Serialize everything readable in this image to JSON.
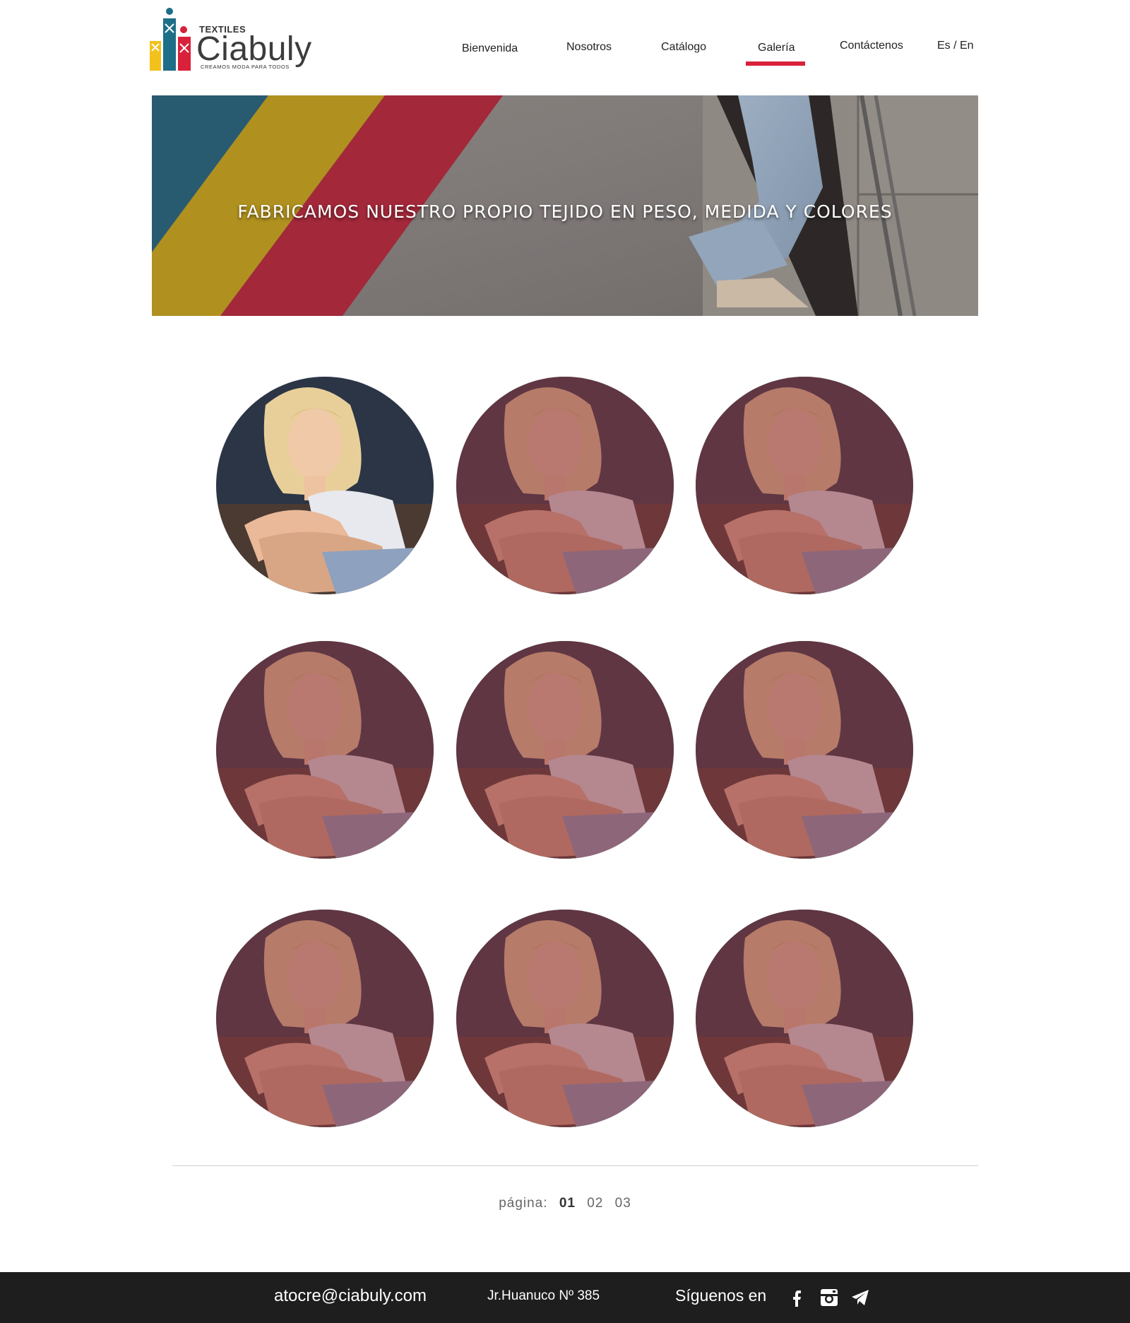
{
  "brand": {
    "small": "TEXTILES",
    "name": "Ciabuly",
    "tagline": "CREAMOS MODA PARA TODOS",
    "colors": {
      "blue": "#1e6e88",
      "yellow": "#f2c11c",
      "red": "#d9213b"
    }
  },
  "nav": {
    "items": [
      {
        "label": "Bienvenida"
      },
      {
        "label": "Nosotros"
      },
      {
        "label": "Catálogo"
      },
      {
        "label": "Galería",
        "active": true
      },
      {
        "label": "Contáctenos"
      }
    ],
    "language": "Es / En",
    "active_color": "#d9213b"
  },
  "banner": {
    "title": "FABRICAMOS NUESTRO PROPIO TEJIDO EN PESO, MEDIDA Y COLORES",
    "stripe_colors": [
      "#295b70",
      "#b0901f",
      "#a2283a"
    ]
  },
  "gallery": {
    "items": [
      {
        "selected": true
      },
      {
        "selected": false
      },
      {
        "selected": false
      },
      {
        "selected": false
      },
      {
        "selected": false
      },
      {
        "selected": false
      },
      {
        "selected": false
      },
      {
        "selected": false
      },
      {
        "selected": false
      }
    ],
    "overlay_color": "#8c3741"
  },
  "pagination": {
    "label": "página:",
    "pages": [
      "01",
      "02",
      "03"
    ],
    "current": "01"
  },
  "footer": {
    "email": "atocre@ciabuly.com",
    "address": "Jr.Huanuco Nº 385",
    "follow": "Síguenos en",
    "social": [
      "facebook-icon",
      "instagram-icon",
      "telegram-icon"
    ]
  }
}
